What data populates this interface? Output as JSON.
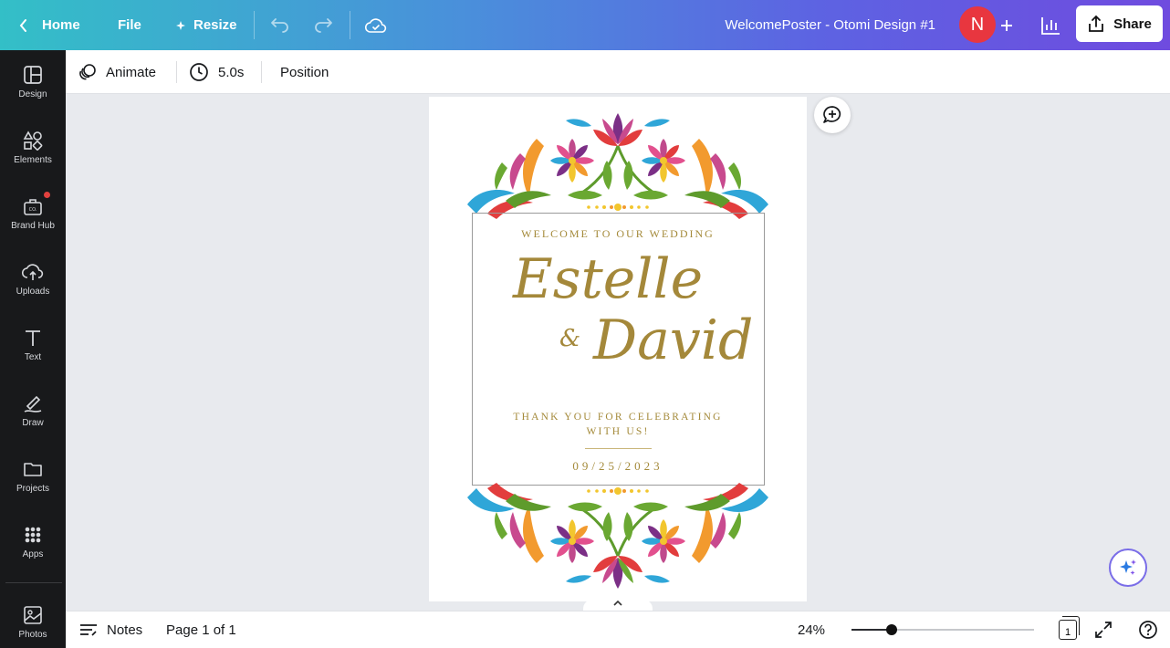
{
  "topbar": {
    "home_label": "Home",
    "file_label": "File",
    "resize_label": "Resize",
    "document_title": "WelcomePoster - Otomi Design #1",
    "avatar_initial": "N",
    "share_label": "Share"
  },
  "sidebar": {
    "items": [
      {
        "label": "Design",
        "icon": "layout-icon"
      },
      {
        "label": "Elements",
        "icon": "shapes-icon"
      },
      {
        "label": "Brand Hub",
        "icon": "briefcase-icon"
      },
      {
        "label": "Uploads",
        "icon": "cloud-upload-icon"
      },
      {
        "label": "Text",
        "icon": "text-t-icon"
      },
      {
        "label": "Draw",
        "icon": "pen-icon"
      },
      {
        "label": "Projects",
        "icon": "folder-icon"
      },
      {
        "label": "Apps",
        "icon": "apps-grid-icon"
      },
      {
        "label": "Photos",
        "icon": "image-icon"
      }
    ]
  },
  "context_toolbar": {
    "animate_label": "Animate",
    "duration_label": "5.0s",
    "position_label": "Position"
  },
  "poster": {
    "welcome": "WELCOME TO OUR WEDDING",
    "name1": "Estelle",
    "ampersand": "&",
    "name2": "David",
    "thanks_line1": "THANK YOU FOR CELEBRATING",
    "thanks_line2": "WITH US!",
    "date": "09/25/2023"
  },
  "footer": {
    "notes_label": "Notes",
    "page_indicator": "Page 1 of 1",
    "zoom_label": "24%",
    "zoom_fraction": 0.22,
    "page_count": "1"
  },
  "colors": {
    "accent_gold": "#a4883a",
    "avatar_red": "#e8363f",
    "sidebar_bg": "#18191b"
  }
}
